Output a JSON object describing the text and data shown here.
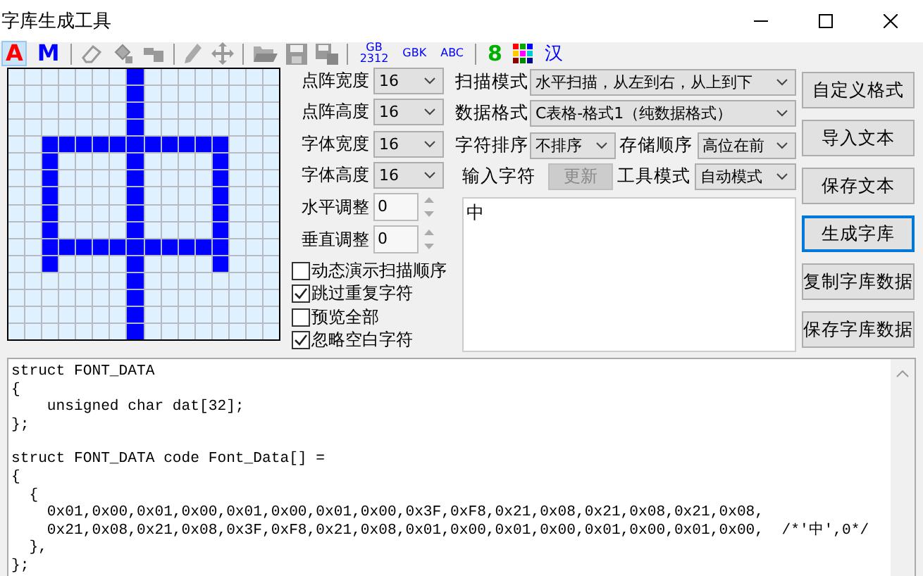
{
  "window": {
    "title": "字库生成工具"
  },
  "toolbar": {
    "text_buttons": [
      {
        "label": "A",
        "color": "#ff0000",
        "selected": true
      },
      {
        "label": "M",
        "color": "#0000ff",
        "selected": false
      }
    ],
    "charset_buttons": [
      {
        "label": "GB\n2312"
      },
      {
        "label": "GBK"
      },
      {
        "label": "ABC"
      }
    ],
    "digit_button": {
      "label": "8"
    },
    "hanzi_button": {
      "label": "汉"
    }
  },
  "bitmap": [
    [
      false,
      false,
      false,
      false,
      false,
      false,
      false,
      true,
      false,
      false,
      false,
      false,
      false,
      false,
      false,
      false
    ],
    [
      false,
      false,
      false,
      false,
      false,
      false,
      false,
      true,
      false,
      false,
      false,
      false,
      false,
      false,
      false,
      false
    ],
    [
      false,
      false,
      false,
      false,
      false,
      false,
      false,
      true,
      false,
      false,
      false,
      false,
      false,
      false,
      false,
      false
    ],
    [
      false,
      false,
      false,
      false,
      false,
      false,
      false,
      true,
      false,
      false,
      false,
      false,
      false,
      false,
      false,
      false
    ],
    [
      false,
      false,
      true,
      true,
      true,
      true,
      true,
      true,
      true,
      true,
      true,
      true,
      true,
      false,
      false,
      false
    ],
    [
      false,
      false,
      true,
      false,
      false,
      false,
      false,
      true,
      false,
      false,
      false,
      false,
      true,
      false,
      false,
      false
    ],
    [
      false,
      false,
      true,
      false,
      false,
      false,
      false,
      true,
      false,
      false,
      false,
      false,
      true,
      false,
      false,
      false
    ],
    [
      false,
      false,
      true,
      false,
      false,
      false,
      false,
      true,
      false,
      false,
      false,
      false,
      true,
      false,
      false,
      false
    ],
    [
      false,
      false,
      true,
      false,
      false,
      false,
      false,
      true,
      false,
      false,
      false,
      false,
      true,
      false,
      false,
      false
    ],
    [
      false,
      false,
      true,
      false,
      false,
      false,
      false,
      true,
      false,
      false,
      false,
      false,
      true,
      false,
      false,
      false
    ],
    [
      false,
      false,
      true,
      true,
      true,
      true,
      true,
      true,
      true,
      true,
      true,
      true,
      true,
      false,
      false,
      false
    ],
    [
      false,
      false,
      true,
      false,
      false,
      false,
      false,
      true,
      false,
      false,
      false,
      false,
      true,
      false,
      false,
      false
    ],
    [
      false,
      false,
      false,
      false,
      false,
      false,
      false,
      true,
      false,
      false,
      false,
      false,
      false,
      false,
      false,
      false
    ],
    [
      false,
      false,
      false,
      false,
      false,
      false,
      false,
      true,
      false,
      false,
      false,
      false,
      false,
      false,
      false,
      false
    ],
    [
      false,
      false,
      false,
      false,
      false,
      false,
      false,
      true,
      false,
      false,
      false,
      false,
      false,
      false,
      false,
      false
    ],
    [
      false,
      false,
      false,
      false,
      false,
      false,
      false,
      true,
      false,
      false,
      false,
      false,
      false,
      false,
      false,
      false
    ]
  ],
  "size_settings": [
    {
      "label": "点阵宽度",
      "value": "16"
    },
    {
      "label": "点阵高度",
      "value": "16"
    },
    {
      "label": "字体宽度",
      "value": "16"
    },
    {
      "label": "字体高度",
      "value": "16"
    }
  ],
  "adjustments": [
    {
      "label": "水平调整",
      "value": "0"
    },
    {
      "label": "垂直调整",
      "value": "0"
    }
  ],
  "options": [
    {
      "label": "动态演示扫描顺序",
      "checked": false
    },
    {
      "label": "跳过重复字符",
      "checked": true
    },
    {
      "label": "预览全部",
      "checked": false
    },
    {
      "label": "忽略空白字符",
      "checked": true
    }
  ],
  "scan_mode": {
    "label": "扫描模式",
    "value": "水平扫描，从左到右，从上到下"
  },
  "data_format": {
    "label": "数据格式",
    "value": "C表格-格式1（纯数据格式）"
  },
  "char_sort": {
    "label": "字符排序",
    "value": "不排序"
  },
  "storage_order": {
    "label": "存储顺序",
    "value": "高位在前"
  },
  "input_label": "输入字符",
  "update_button": {
    "label": "更新",
    "disabled": true
  },
  "tool_mode": {
    "label": "工具模式",
    "value": "自动模式"
  },
  "input_text": "中",
  "buttons": [
    {
      "label": "自定义格式",
      "focused": false
    },
    {
      "label": "导入文本",
      "focused": false
    },
    {
      "label": "保存文本",
      "focused": false
    },
    {
      "label": "生成字库",
      "focused": true
    },
    {
      "label": "复制字库数据",
      "focused": false
    },
    {
      "label": "保存字库数据",
      "focused": false
    }
  ],
  "output_blocks": [
    [
      "struct FONT_DATA",
      "{",
      "    unsigned char dat[32];",
      "};"
    ],
    [
      "struct FONT_DATA code Font_Data[] =",
      "{",
      "  {",
      "    0x01,0x00,0x01,0x00,0x01,0x00,0x01,0x00,0x3F,0xF8,0x21,0x08,0x21,0x08,0x21,0x08,",
      "    0x21,0x08,0x21,0x08,0x3F,0xF8,0x21,0x08,0x01,0x00,0x01,0x00,0x01,0x00,0x01,0x00,  /*'中',0*/",
      "  },",
      "};"
    ]
  ]
}
